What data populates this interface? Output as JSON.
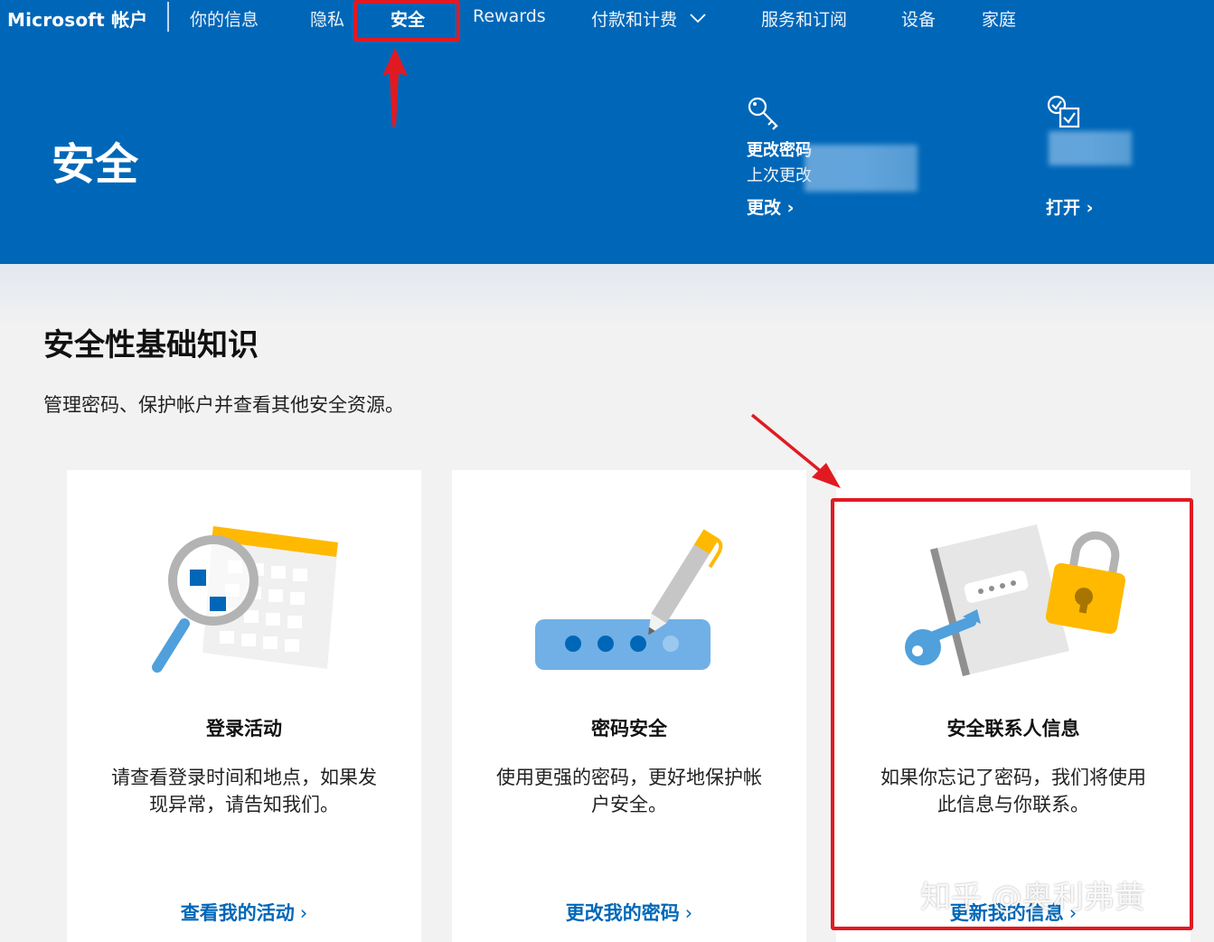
{
  "header": {
    "brand": "Microsoft 帐户",
    "nav": [
      {
        "label": "你的信息"
      },
      {
        "label": "隐私"
      },
      {
        "label": "安全",
        "active": true
      },
      {
        "label": "Rewards"
      },
      {
        "label": "付款和计费",
        "has_dropdown": true
      },
      {
        "label": "服务和订阅"
      },
      {
        "label": "设备"
      },
      {
        "label": "家庭"
      }
    ],
    "page_title": "安全",
    "quick_actions": [
      {
        "icon": "key-icon",
        "title": "更改密码",
        "subtitle": "上次更改",
        "link": "更改"
      },
      {
        "icon": "checklist-icon",
        "title": "",
        "subtitle": "",
        "link": "打开"
      }
    ]
  },
  "section": {
    "title": "安全性基础知识",
    "subtitle": "管理密码、保护帐户并查看其他安全资源。"
  },
  "cards": [
    {
      "illustration": "magnifier-calendar-illustration",
      "title": "登录活动",
      "desc_line1": "请查看登录时间和地点，如果发",
      "desc_line2": "现异常，请告知我们。",
      "link": "查看我的活动"
    },
    {
      "illustration": "password-pen-illustration",
      "title": "密码安全",
      "desc_line1": "使用更强的密码，更好地保护帐",
      "desc_line2": "户安全。",
      "link": "更改我的密码"
    },
    {
      "illustration": "notebook-lock-key-illustration",
      "title": "安全联系人信息",
      "desc_line1": "如果你忘记了密码，我们将使用",
      "desc_line2": "此信息与你联系。",
      "link": "更新我的信息"
    }
  ],
  "watermark": "知乎 @奥利弗黄",
  "colors": {
    "brand_blue": "#0067b8",
    "annotation_red": "#e11a22",
    "accent_yellow": "#ffb900",
    "light_blue": "#50a0dc"
  }
}
